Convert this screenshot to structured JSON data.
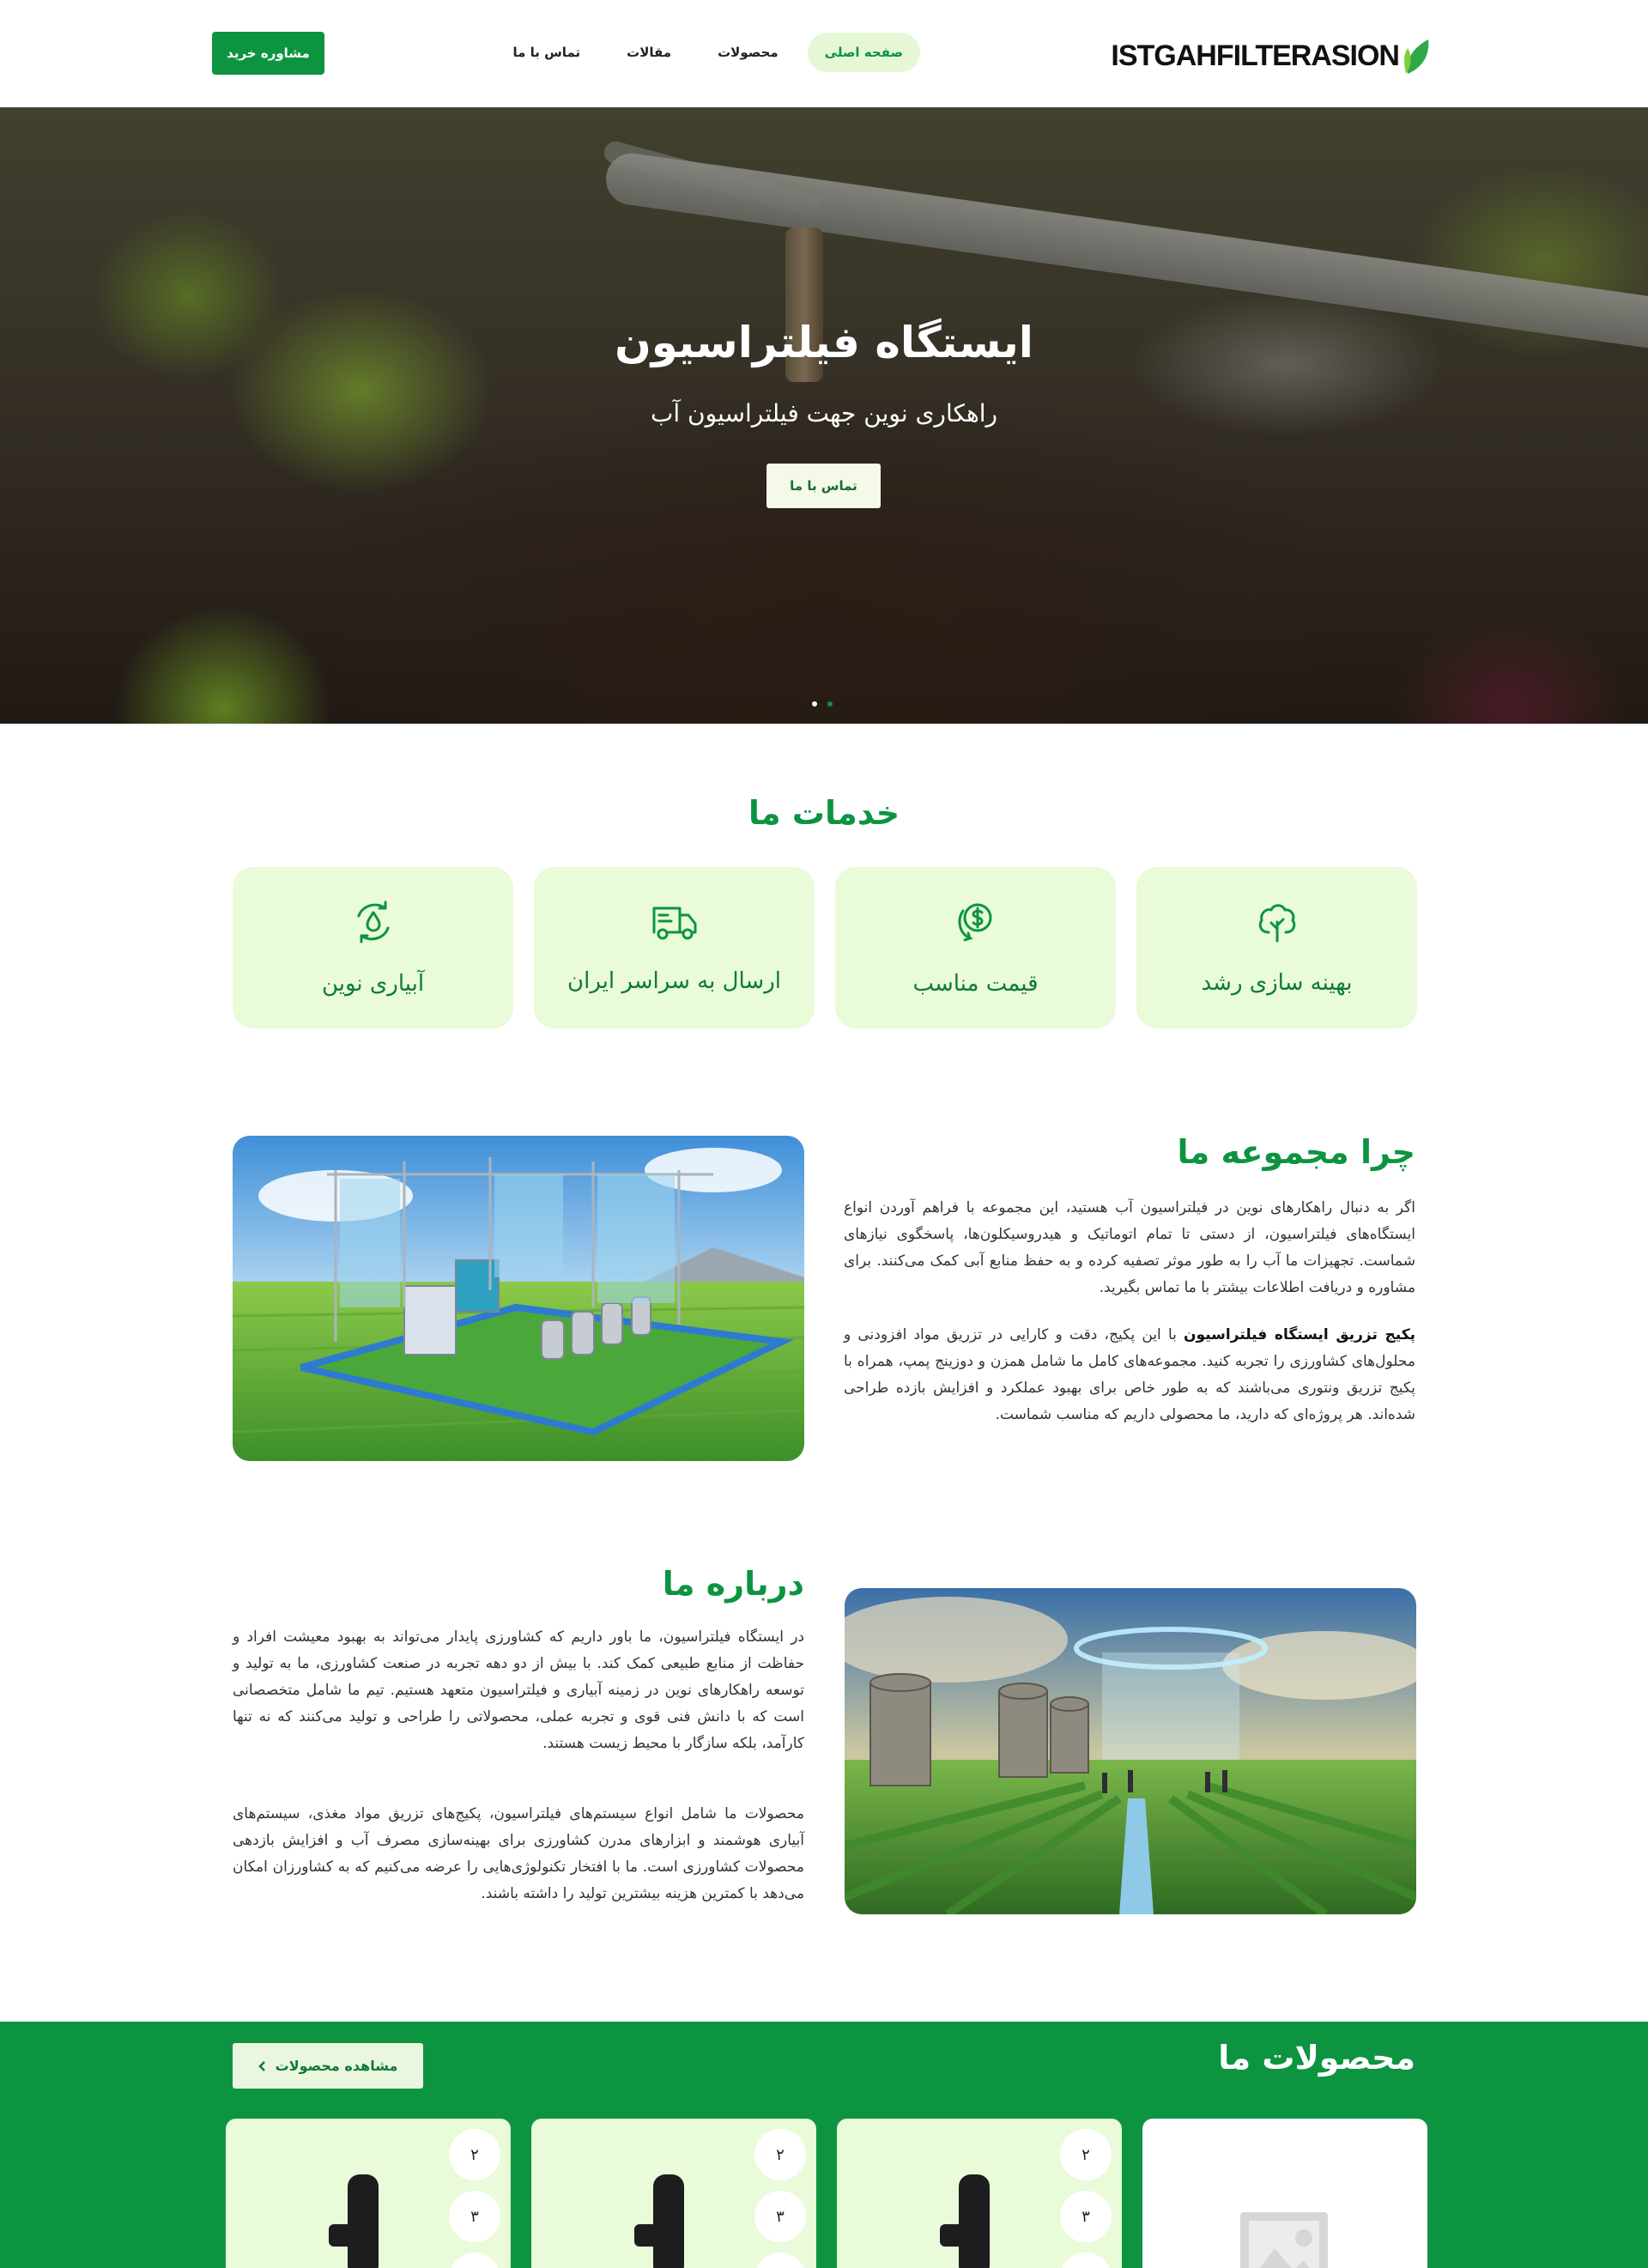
{
  "header": {
    "logo_text": "ISTGAHFILTERASION",
    "nav": [
      {
        "label": "صفحه اصلی",
        "active": true
      },
      {
        "label": "محصولات",
        "active": false
      },
      {
        "label": "مقالات",
        "active": false
      },
      {
        "label": "تماس با ما",
        "active": false
      }
    ],
    "cta_label": "مشاوره خرید"
  },
  "hero": {
    "title": "ایستگاه فیلتراسیون",
    "subtitle": "راهکاری نوین جهت فیلتراسیون آب",
    "button_label": "تماس با ما",
    "slides": 2,
    "active_slide": 2
  },
  "services": {
    "title": "خدمات ما",
    "items": [
      {
        "label": "بهینه سازی رشد",
        "icon": "tree-icon"
      },
      {
        "label": "قیمت مناسب",
        "icon": "dollar-icon"
      },
      {
        "label": "ارسال به سراسر ایران",
        "icon": "truck-icon"
      },
      {
        "label": "آبیاری نوین",
        "icon": "water-cycle-icon"
      }
    ]
  },
  "why": {
    "title": "چرا مجموعه ما",
    "para1": "اگر به دنبال راهکارهای نوین در فیلتراسیون آب هستید، این مجموعه با فراهم آوردن انواع ایستگاه‌های فیلتراسیون، از دستی تا تمام اتوماتیک و هیدروسیکلون‌ها، پاسخگوی نیازهای شماست. تجهیزات ما آب را به طور موثر تصفیه کرده و به حفظ منابع آبی کمک می‌کنند. برای مشاوره و دریافت اطلاعات بیشتر با ما تماس بگیرید.",
    "para2_bold": "پکیج تزریق ایستگاه فیلتراسیون",
    "para2_rest": " با این پکیج، دقت و کارایی در تزریق مواد افزودنی و محلول‌های کشاورزی را تجربه کنید. مجموعه‌های کامل ما شامل همزن و دوزینج پمپ، همراه با پکیج تزریق ونتوری می‌باشند که به طور خاص برای بهبود عملکرد و افزایش بازده طراحی شده‌اند. هر پروژه‌ای که دارید، ما محصولی داریم که مناسب شماست."
  },
  "about": {
    "title": "درباره ما",
    "para1": "در ایستگاه فیلتراسیون، ما باور داریم که کشاورزی پایدار می‌تواند به بهبود معیشت افراد و حفاظت از منابع طبیعی کمک کند. با بیش از دو دهه تجربه در صنعت کشاورزی، ما به تولید و توسعه راهکارهای نوین در زمینه آبیاری و فیلتراسیون متعهد هستیم. تیم ما شامل متخصصانی است که با دانش فنی قوی و تجربه عملی، محصولاتی را طراحی و تولید می‌کنند که نه تنها کارآمد، بلکه سازگار با محیط زیست هستند.",
    "para2": "محصولات ما شامل انواع سیستم‌های فیلتراسیون، پکیج‌های تزریق مواد مغذی، سیستم‌های آبیاری هوشمند و ابزارهای مدرن کشاورزی برای بهینه‌سازی مصرف آب و افزایش بازدهی محصولات کشاورزی است. ما با افتخار تکنولوژی‌هایی را عرضه می‌کنیم که به کشاورزان امکان می‌دهد با کمترین هزینه بیشترین تولید را داشته باشند."
  },
  "products": {
    "title": "محصولات ما",
    "button_label": "مشاهده محصولات",
    "cards": [
      {
        "thumbs": [
          "۲",
          "۳"
        ],
        "placeholder": false
      },
      {
        "thumbs": [
          "۲",
          "۳"
        ],
        "placeholder": false
      },
      {
        "thumbs": [
          "۲",
          "۳"
        ],
        "placeholder": false
      },
      {
        "thumbs": [],
        "placeholder": true
      }
    ]
  },
  "colors": {
    "brand_green": "#0d9441",
    "light_green": "#e9fbd8"
  }
}
